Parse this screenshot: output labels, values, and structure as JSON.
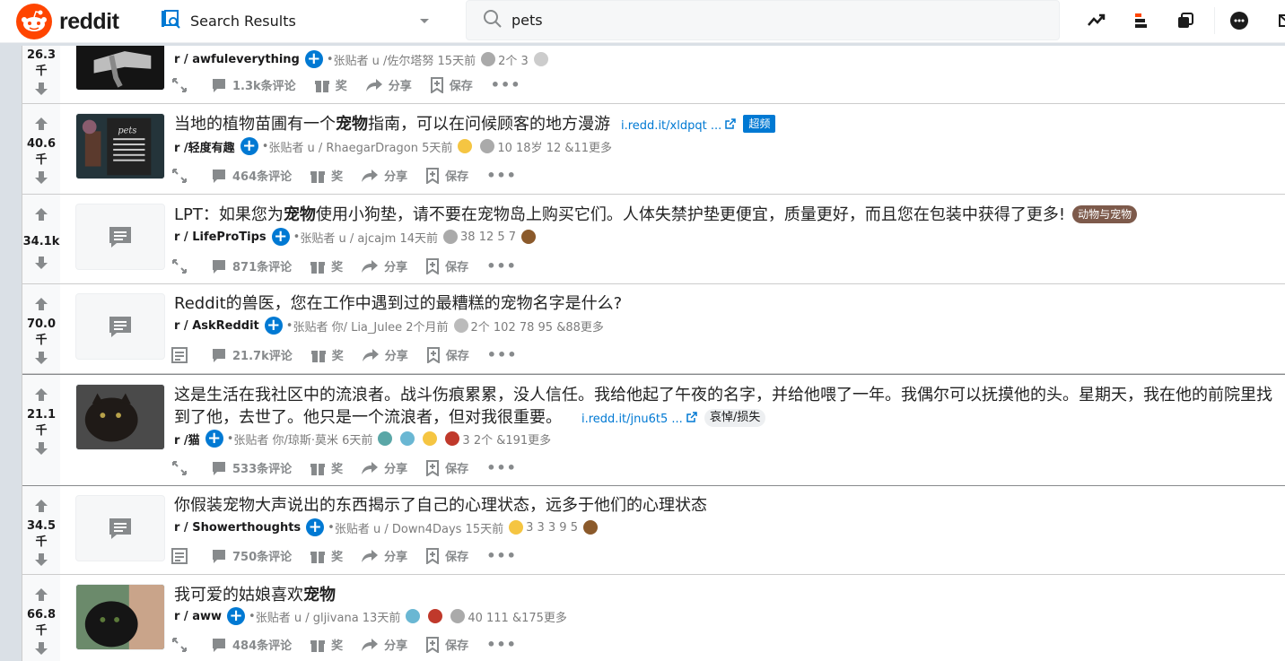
{
  "header": {
    "brand": "reddit",
    "tab_label": "Search Results",
    "search_value": "pets"
  },
  "posts": [
    {
      "score_line1": "26.3",
      "score_line2": "千",
      "title": "",
      "subreddit": "r / awfuleverything",
      "posted_by": "张贴者 u /佐尔塔努 15天前",
      "awards_text": "2个 3",
      "comments": "1.3k条评论"
    },
    {
      "score_line1": "40.6",
      "score_line2": "千",
      "title_pre": "当地的植物苗圃有一个",
      "title_bold": "宠物",
      "title_post": "指南，可以在问候顾客的地方漫游",
      "link": "i.redd.it/xldpqt ...",
      "flair": "超频",
      "subreddit": "r /轻度有趣",
      "posted_by": "张贴者 u / RhaegarDragon 5天前",
      "awards_text": "10 18岁 12 &11更多",
      "comments": "464条评论"
    },
    {
      "score_line1": "34.1k",
      "score_line2": "",
      "title_pre": "LPT：如果您为",
      "title_bold": "宠物",
      "title_post": "使用小狗垫，请不要在宠物岛上购买它们。人体失禁护垫更便宜，质量更好，而且您在包装中获得了更多!",
      "flair": "动物与宠物",
      "subreddit": "r / LifeProTips",
      "posted_by": "张贴者 u / ajcajm 14天前",
      "awards_text": "38 12 5 7",
      "comments": "871条评论"
    },
    {
      "score_line1": "70.0",
      "score_line2": "千",
      "title": "Reddit的兽医，您在工作中遇到过的最糟糕的宠物名字是什么?",
      "subreddit": "r / AskReddit",
      "posted_by": "张贴者 你/ Lia_Julee 2个月前",
      "awards_text": "2个 102 78 95 &88更多",
      "comments": "21.7k评论"
    },
    {
      "score_line1": "21.1",
      "score_line2": "千",
      "title": "这是生活在我社区中的流浪者。战斗伤痕累累，没人信任。我给他起了午夜的名字，并给他喂了一年。我偶尔可以抚摸他的头。星期天，我在他的前院里找到了他，去世了。他只是一个流浪者，但对我很重要。",
      "link": "i.redd.it/jnu6t5 ...",
      "flair": "哀悼/损失",
      "subreddit": "r /猫",
      "posted_by": "张贴者 你/琼斯·莫米 6天前",
      "awards_text": "3 2个 &191更多",
      "comments": "533条评论"
    },
    {
      "score_line1": "34.5",
      "score_line2": "千",
      "title": "你假装宠物大声说出的东西揭示了自己的心理状态，远多于他们的心理状态",
      "subreddit": "r / Showerthoughts",
      "posted_by": "张贴者 u / Down4Days 15天前",
      "awards_text": "3 3 3 9 5",
      "comments": "750条评论"
    },
    {
      "score_line1": "66.8",
      "score_line2": "千",
      "title_pre": "我可爱的姑娘喜欢",
      "title_bold": "宠物",
      "title_post": "",
      "subreddit": "r / aww",
      "posted_by": "张贴者 u / gljivana 13天前",
      "awards_text": "40 111 &175更多",
      "comments": "484条评论"
    }
  ],
  "actions": {
    "award": "奖",
    "share": "分享",
    "save": "保存",
    "more": "•••"
  },
  "colors": {
    "accent": "#0079d3",
    "brand": "#ff4500",
    "flair_pets_bg": "#7d5a4b",
    "flair_grief_bg": "#edeff1",
    "flair_blue_bg": "#0079d3"
  }
}
